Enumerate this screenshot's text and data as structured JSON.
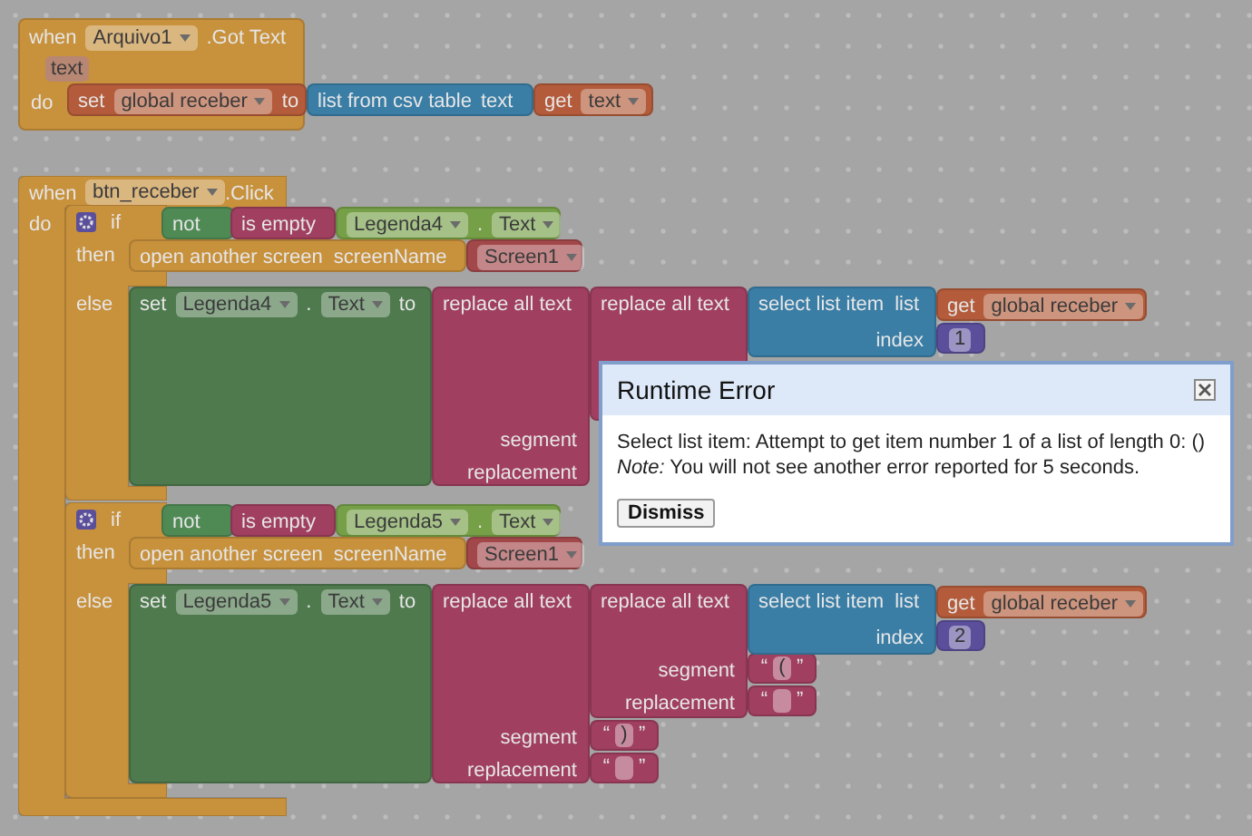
{
  "workspace": {
    "got_text_event": {
      "when": "when",
      "component": "Arquivo1",
      "event": ".Got Text",
      "parameter": "text",
      "do": "do",
      "set_variable": {
        "label": "set",
        "variable": "global receber",
        "to": "to"
      },
      "csv_block": {
        "label": "list from csv table",
        "socket": "text"
      },
      "get_block": {
        "label": "get",
        "variable": "text"
      }
    },
    "click_event": {
      "when": "when",
      "component": "btn_receber",
      "event": ".Click",
      "do": "do",
      "if_blocks": [
        {
          "if": "if",
          "then": "then",
          "else": "else",
          "not": "not",
          "is_empty": "is empty",
          "component": "Legenda4",
          "dot": ".",
          "property": "Text",
          "open_screen": "open another screen",
          "screen_name_label": "screenName",
          "screen": "Screen1",
          "set": {
            "label": "set",
            "component": "Legenda4",
            "dot": ".",
            "property": "Text",
            "to": "to"
          },
          "outer_replace": {
            "label": "replace all text",
            "segment": "segment",
            "replacement": "replacement"
          },
          "inner_replace": {
            "label": "replace all text"
          },
          "select_item": {
            "label": "select list item",
            "list": "list",
            "index": "index",
            "get": "get",
            "variable": "global receber",
            "number": "1"
          }
        },
        {
          "if": "if",
          "then": "then",
          "else": "else",
          "not": "not",
          "is_empty": "is empty",
          "component": "Legenda5",
          "dot": ".",
          "property": "Text",
          "open_screen": "open another screen",
          "screen_name_label": "screenName",
          "screen": "Screen1",
          "set": {
            "label": "set",
            "component": "Legenda5",
            "dot": ".",
            "property": "Text",
            "to": "to"
          },
          "outer_replace": {
            "label": "replace all text",
            "segment": "segment",
            "replacement": "replacement",
            "segment_value": {
              "open": "“",
              "value": ")",
              "close": "”"
            },
            "replacement_value": {
              "open": "“",
              "close": "”"
            }
          },
          "inner_replace": {
            "label": "replace all text",
            "segment": "segment",
            "replacement": "replacement",
            "segment_value": {
              "open": "“",
              "value": "(",
              "close": "”"
            },
            "replacement_value": {
              "open": "“",
              "close": "”"
            }
          },
          "select_item": {
            "label": "select list item",
            "list": "list",
            "index": "index",
            "get": "get",
            "variable": "global receber",
            "number": "2"
          }
        }
      ]
    }
  },
  "dialog": {
    "title": "Runtime Error",
    "message": "Select list item: Attempt to get item number 1 of a list of length 0: ()",
    "note": "*Note:* You will not see another error reported for 5 seconds.",
    "button": "Dismiss"
  }
}
